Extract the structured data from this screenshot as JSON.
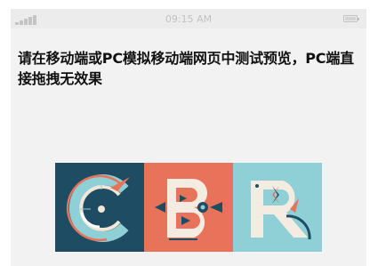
{
  "statusbar": {
    "time": "09:15 AM",
    "signal_icon": "signal-bars-icon",
    "battery_icon": "battery-icon"
  },
  "notice": {
    "text": "请在移动端或PC模拟移动端网页中测试预览，PC端直接拖拽无效果"
  },
  "gallery": {
    "tiles": [
      {
        "letter": "C",
        "background": "#1e4d63"
      },
      {
        "letter": "B",
        "background": "#e8735a"
      },
      {
        "letter": "R",
        "background": "#8fcfd6"
      }
    ]
  },
  "colors": {
    "screen_bg": "#f2f2f2",
    "statusbar_bg": "#ececec",
    "status_text": "#c2c2c2",
    "notice_text": "#111111"
  }
}
